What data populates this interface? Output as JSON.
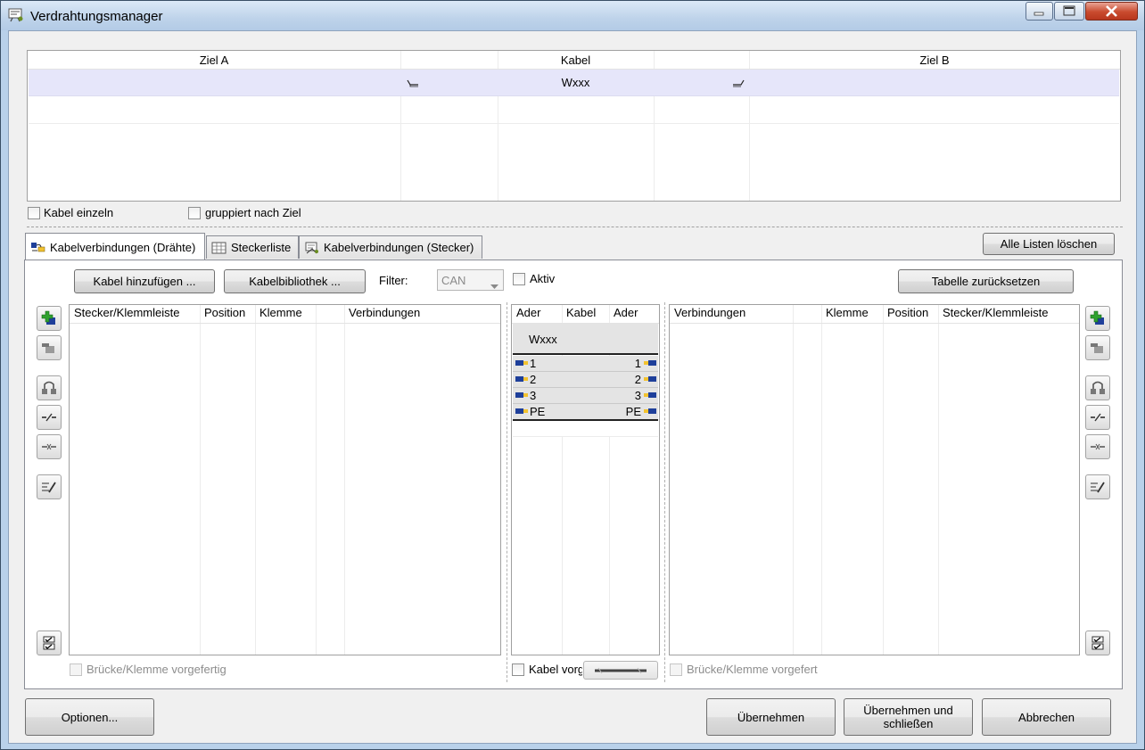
{
  "window": {
    "title": "Verdrahtungsmanager"
  },
  "top_grid": {
    "columns": {
      "ziel_a": "Ziel A",
      "kabel": "Kabel",
      "ziel_b": "Ziel B"
    },
    "rows": [
      {
        "kabel": "Wxxx"
      }
    ]
  },
  "options": {
    "kabel_einzeln": "Kabel einzeln",
    "gruppiert_nach_ziel": "gruppiert nach Ziel"
  },
  "tabs": [
    {
      "label": "Kabelverbindungen (Drähte)",
      "icon": "wire-connection-icon",
      "active": true
    },
    {
      "label": "Steckerliste",
      "icon": "table-icon",
      "active": false
    },
    {
      "label": "Kabelverbindungen (Stecker)",
      "icon": "plug-connection-icon",
      "active": false
    }
  ],
  "toolbar": {
    "alle_listen_loeschen": "Alle Listen löschen",
    "kabel_hinzufuegen": "Kabel hinzufügen ...",
    "kabelbibliothek": "Kabelbibliothek ...",
    "filter_label": "Filter:",
    "filter_value": "CAN",
    "aktiv": "Aktiv",
    "tabelle_zuruecksetzen": "Tabelle zurücksetzen"
  },
  "left_list": {
    "columns": [
      "Stecker/Klemmleiste",
      "Position",
      "Klemme",
      "",
      "Verbindungen"
    ],
    "footer_checkbox": "Brücke/Klemme vorgefertig"
  },
  "middle_list": {
    "columns": [
      "Ader",
      "Kabel",
      "Ader"
    ],
    "cable_name": "Wxxx",
    "cores": [
      {
        "left": "1",
        "right": "1"
      },
      {
        "left": "2",
        "right": "2"
      },
      {
        "left": "3",
        "right": "3"
      },
      {
        "left": "PE",
        "right": "PE"
      }
    ],
    "footer_checkbox": "Kabel vorg"
  },
  "right_list": {
    "columns": [
      "Verbindungen",
      "",
      "Klemme",
      "Position",
      "Stecker/Klemmleiste"
    ],
    "footer_checkbox": "Brücke/Klemme vorgefert"
  },
  "footer": {
    "optionen": "Optionen...",
    "uebernehmen": "Übernehmen",
    "uebernehmen_schliessen_1": "Übernehmen und",
    "uebernehmen_schliessen_2": "schließen",
    "abbrechen": "Abbrechen"
  },
  "colors": {
    "selected_row": "#e6e6fa",
    "accent_green": "#2fa12f",
    "accent_blue": "#1e3f9a"
  }
}
